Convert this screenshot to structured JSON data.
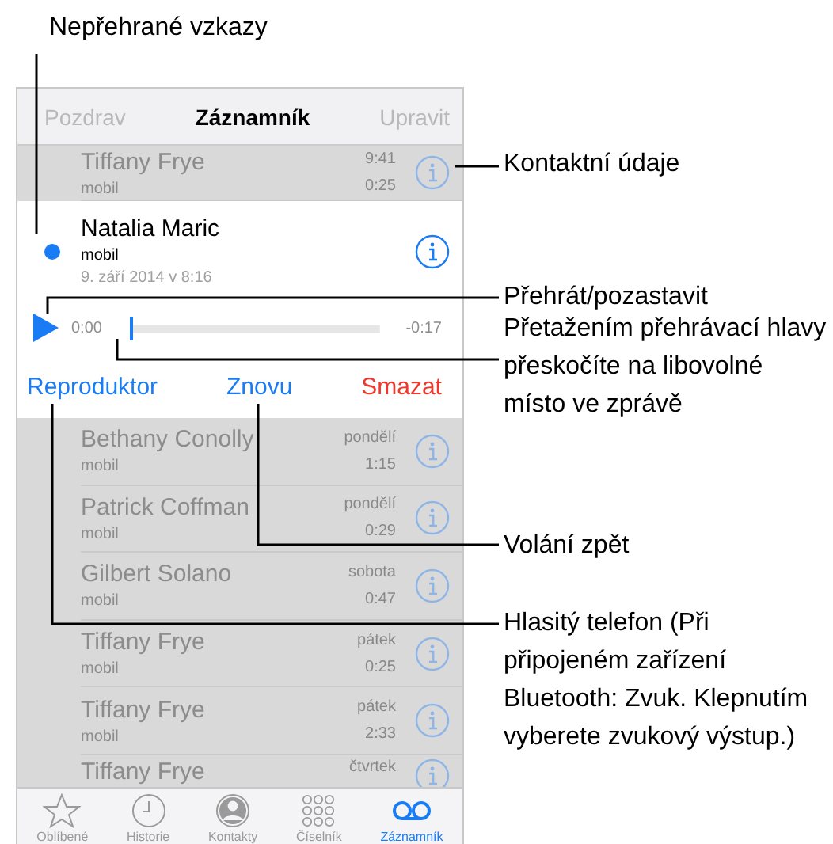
{
  "top_callout": "Nepřehrané vzkazy",
  "nav": {
    "left": "Pozdrav",
    "title": "Záznamník",
    "right": "Upravit"
  },
  "messages": [
    {
      "name": "Tiffany Frye",
      "type": "mobil",
      "when": "9:41",
      "duration": "0:25",
      "expanded": false,
      "unheard": false
    },
    {
      "name": "Natalia Maric",
      "type": "mobil",
      "when": "9. září 2014 v 8:16",
      "expanded": true,
      "unheard": true,
      "player": {
        "elapsed": "0:00",
        "remaining": "-0:17",
        "level": 0,
        "playing": false
      },
      "actions": [
        {
          "label": "Reproduktor",
          "kind": "normal"
        },
        {
          "label": "Znovu",
          "kind": "normal"
        },
        {
          "label": "Smazat",
          "kind": "destructive"
        }
      ]
    },
    {
      "name": "Bethany Conolly",
      "type": "mobil",
      "when": "pondělí",
      "duration": "1:15",
      "expanded": false,
      "unheard": false
    },
    {
      "name": "Patrick Coffman",
      "type": "mobil",
      "when": "pondělí",
      "duration": "0:29",
      "expanded": false,
      "unheard": false
    },
    {
      "name": "Gilbert Solano",
      "type": "mobil",
      "when": "sobota",
      "duration": "0:47",
      "expanded": false,
      "unheard": false
    },
    {
      "name": "Tiffany Frye",
      "type": "mobil",
      "when": "pátek",
      "duration": "0:25",
      "expanded": false,
      "unheard": false
    },
    {
      "name": "Tiffany Frye",
      "type": "mobil",
      "when": "pátek",
      "duration": "2:33",
      "expanded": false,
      "unheard": false
    },
    {
      "name": "Tiffany Frye",
      "when": "čtvrtek",
      "expanded": false,
      "unheard": false
    }
  ],
  "tabs": [
    {
      "label": "Oblíbené",
      "kind": "star",
      "selected": false
    },
    {
      "label": "Historie",
      "kind": "clock",
      "selected": false
    },
    {
      "label": "Kontakty",
      "kind": "person",
      "selected": false
    },
    {
      "label": "Číselník",
      "kind": "keypad",
      "selected": false
    },
    {
      "label": "Záznamník",
      "kind": "voicemail",
      "selected": true
    }
  ],
  "callouts": [
    "Kontaktní údaje",
    "Přehrát/pozastavit",
    "Přetažením přehrávací hlavy přeskočíte na libovolné místo ve zprávě",
    "Volání zpět",
    "Hlasitý telefon (Při připojeném zařízení Bluetooth: Zvuk. Klepnutím vyberete zvukový výstup.)"
  ]
}
